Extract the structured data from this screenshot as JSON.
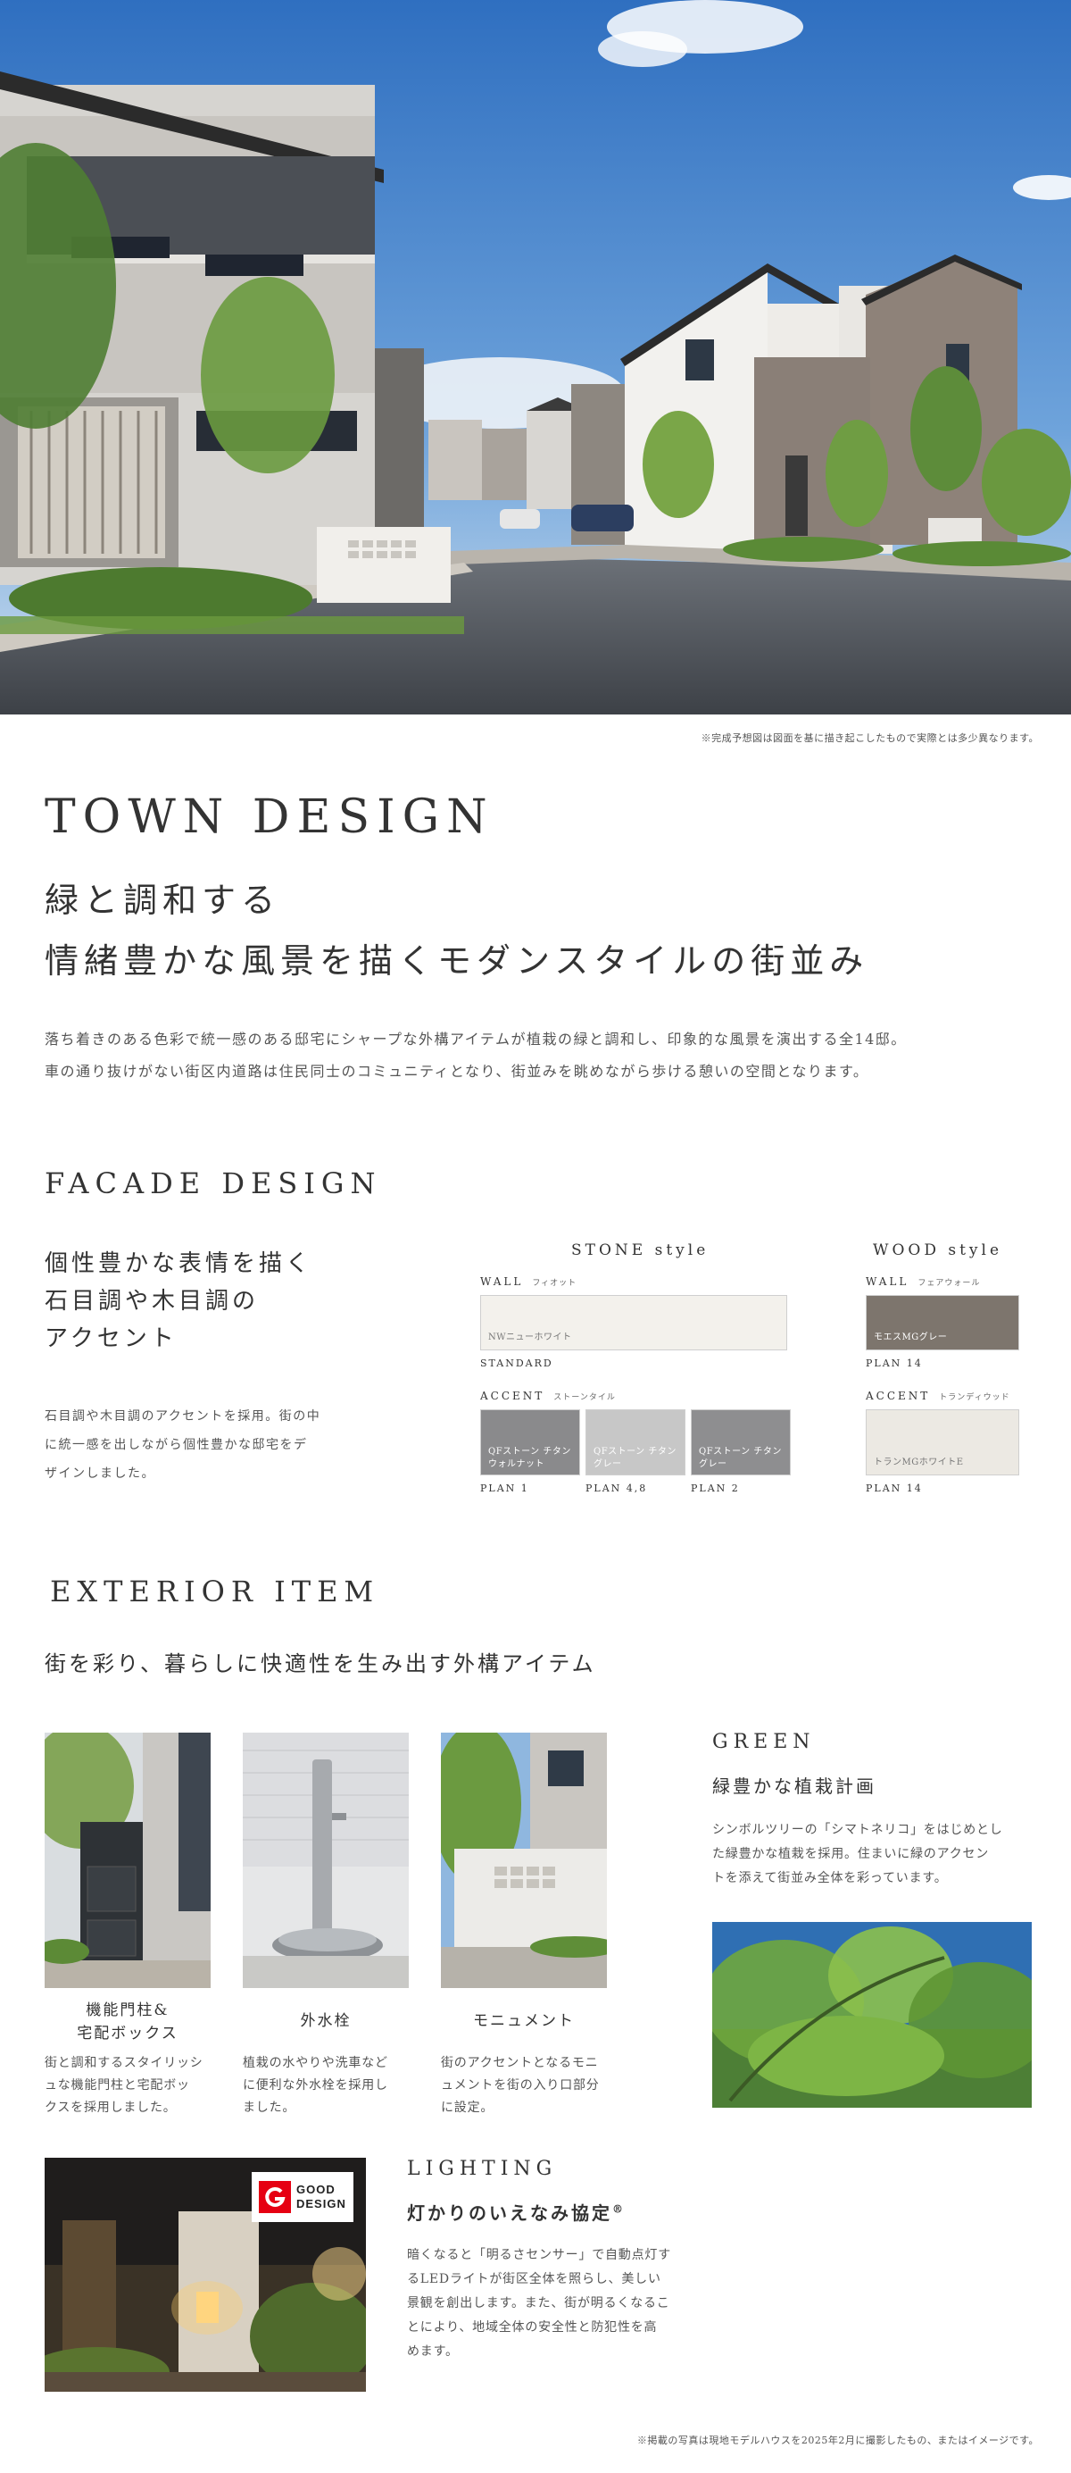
{
  "hero": {
    "image": "town-rendering-image",
    "caption": "※完成予想図は図面を基に描き起こしたもので実際とは多少異なります。"
  },
  "town_design": {
    "heading_en": "TOWN DESIGN",
    "heading_jp_line1": "緑と調和する",
    "heading_jp_line2": "情緒豊かな風景を描くモダンスタイルの街並み",
    "body_line1": "落ち着きのある色彩で統一感のある邸宅にシャープな外構アイテムが植栽の緑と調和し、印象的な風景を演出する全14邸。",
    "body_line2": "車の通り抜けがない街区内道路は住民同士のコミュニティとなり、街並みを眺めながら歩ける憩いの空間となります。"
  },
  "facade_design": {
    "heading_en": "FACADE DESIGN",
    "heading_jp_line1": "個性豊かな表情を描く",
    "heading_jp_line2": "石目調や木目調の",
    "heading_jp_line3": "アクセント",
    "body_line1": "石目調や木目調のアクセントを採用。街の中",
    "body_line2": "に統一感を出しながら個性豊かな邸宅をデ",
    "body_line3": "ザインしました。",
    "stone": {
      "title": "STONE style",
      "wall_label": "WALL",
      "wall_maker": "フィオット",
      "wall_swatch": {
        "name": "NWニューホワイト",
        "color": "#f3f1ec"
      },
      "wall_plan": "STANDARD",
      "accent_label": "ACCENT",
      "accent_maker": "ストーンタイル",
      "accent_swatches": [
        {
          "name_line1": "QFストーン チタン",
          "name_line2": "ウォルナット",
          "plan": "PLAN 1",
          "color": "#8a8a8c"
        },
        {
          "name_line1": "QFストーン チタン",
          "name_line2": "グレー",
          "plan": "PLAN 4,8",
          "color": "#c7c7c7"
        },
        {
          "name_line1": "QFストーン チタン",
          "name_line2": "グレー",
          "plan": "PLAN 2",
          "color": "#8e8e90"
        }
      ]
    },
    "wood": {
      "title": "WOOD style",
      "wall_label": "WALL",
      "wall_maker": "フェアウォール",
      "wall_swatch": {
        "name": "モエスMGグレー",
        "color": "#7d756d"
      },
      "wall_plan": "PLAN 14",
      "accent_label": "ACCENT",
      "accent_maker": "トランディウッド",
      "accent_swatch": {
        "name": "トランMGホワイトE",
        "color": "#ece9e3"
      },
      "accent_plan": "PLAN 14"
    }
  },
  "exterior_item": {
    "heading_en": "EXTERIOR ITEM",
    "heading_jp": "街を彩り、暮らしに快適性を生み出す外構アイテム",
    "items": [
      {
        "title_line1": "機能門柱&",
        "title_line2": "宅配ボックス",
        "desc_line1": "街と調和するスタイリッシ",
        "desc_line2": "ュな機能門柱と宅配ボッ",
        "desc_line3": "クスを採用しました。"
      },
      {
        "title_line1": "外水栓",
        "title_line2": "",
        "desc_line1": "植栽の水やりや洗車など",
        "desc_line2": "に便利な外水栓を採用し",
        "desc_line3": "ました。"
      },
      {
        "title_line1": "モニュメント",
        "title_line2": "",
        "desc_line1": "街のアクセントとなるモニ",
        "desc_line2": "ュメントを街の入り口部分",
        "desc_line3": "に設定。"
      }
    ],
    "green": {
      "heading_en": "GREEN",
      "heading_jp": "緑豊かな植栽計画",
      "body_line1": "シンボルツリーの「シマトネリコ」をはじめとし",
      "body_line2": "た緑豊かな植栽を採用。住まいに緑のアクセン",
      "body_line3": "トを添えて街並み全体を彩っています。"
    },
    "lighting": {
      "heading_en": "LIGHTING",
      "heading_jp": "灯かりのいえなみ協定",
      "heading_mark": "®",
      "badge_line1": "GOOD",
      "badge_line2": "DESIGN",
      "body_line1": "暗くなると「明るさセンサー」で自動点灯す",
      "body_line2": "るLEDライトが街区全体を照らし、美しい",
      "body_line3": "景観を創出します。また、街が明るくなるこ",
      "body_line4": "とにより、地域全体の安全性と防犯性を高",
      "body_line5": "めます。"
    }
  },
  "footer_note": "※掲載の写真は現地モデルハウスを2025年2月に撮影したもの、またはイメージです。",
  "colors": {
    "text": "#333333",
    "muted": "#555555",
    "sky": "#3f7fc9",
    "road": "#4a4e55",
    "green": "#5f8f3a",
    "good_design_red": "#e60012"
  }
}
